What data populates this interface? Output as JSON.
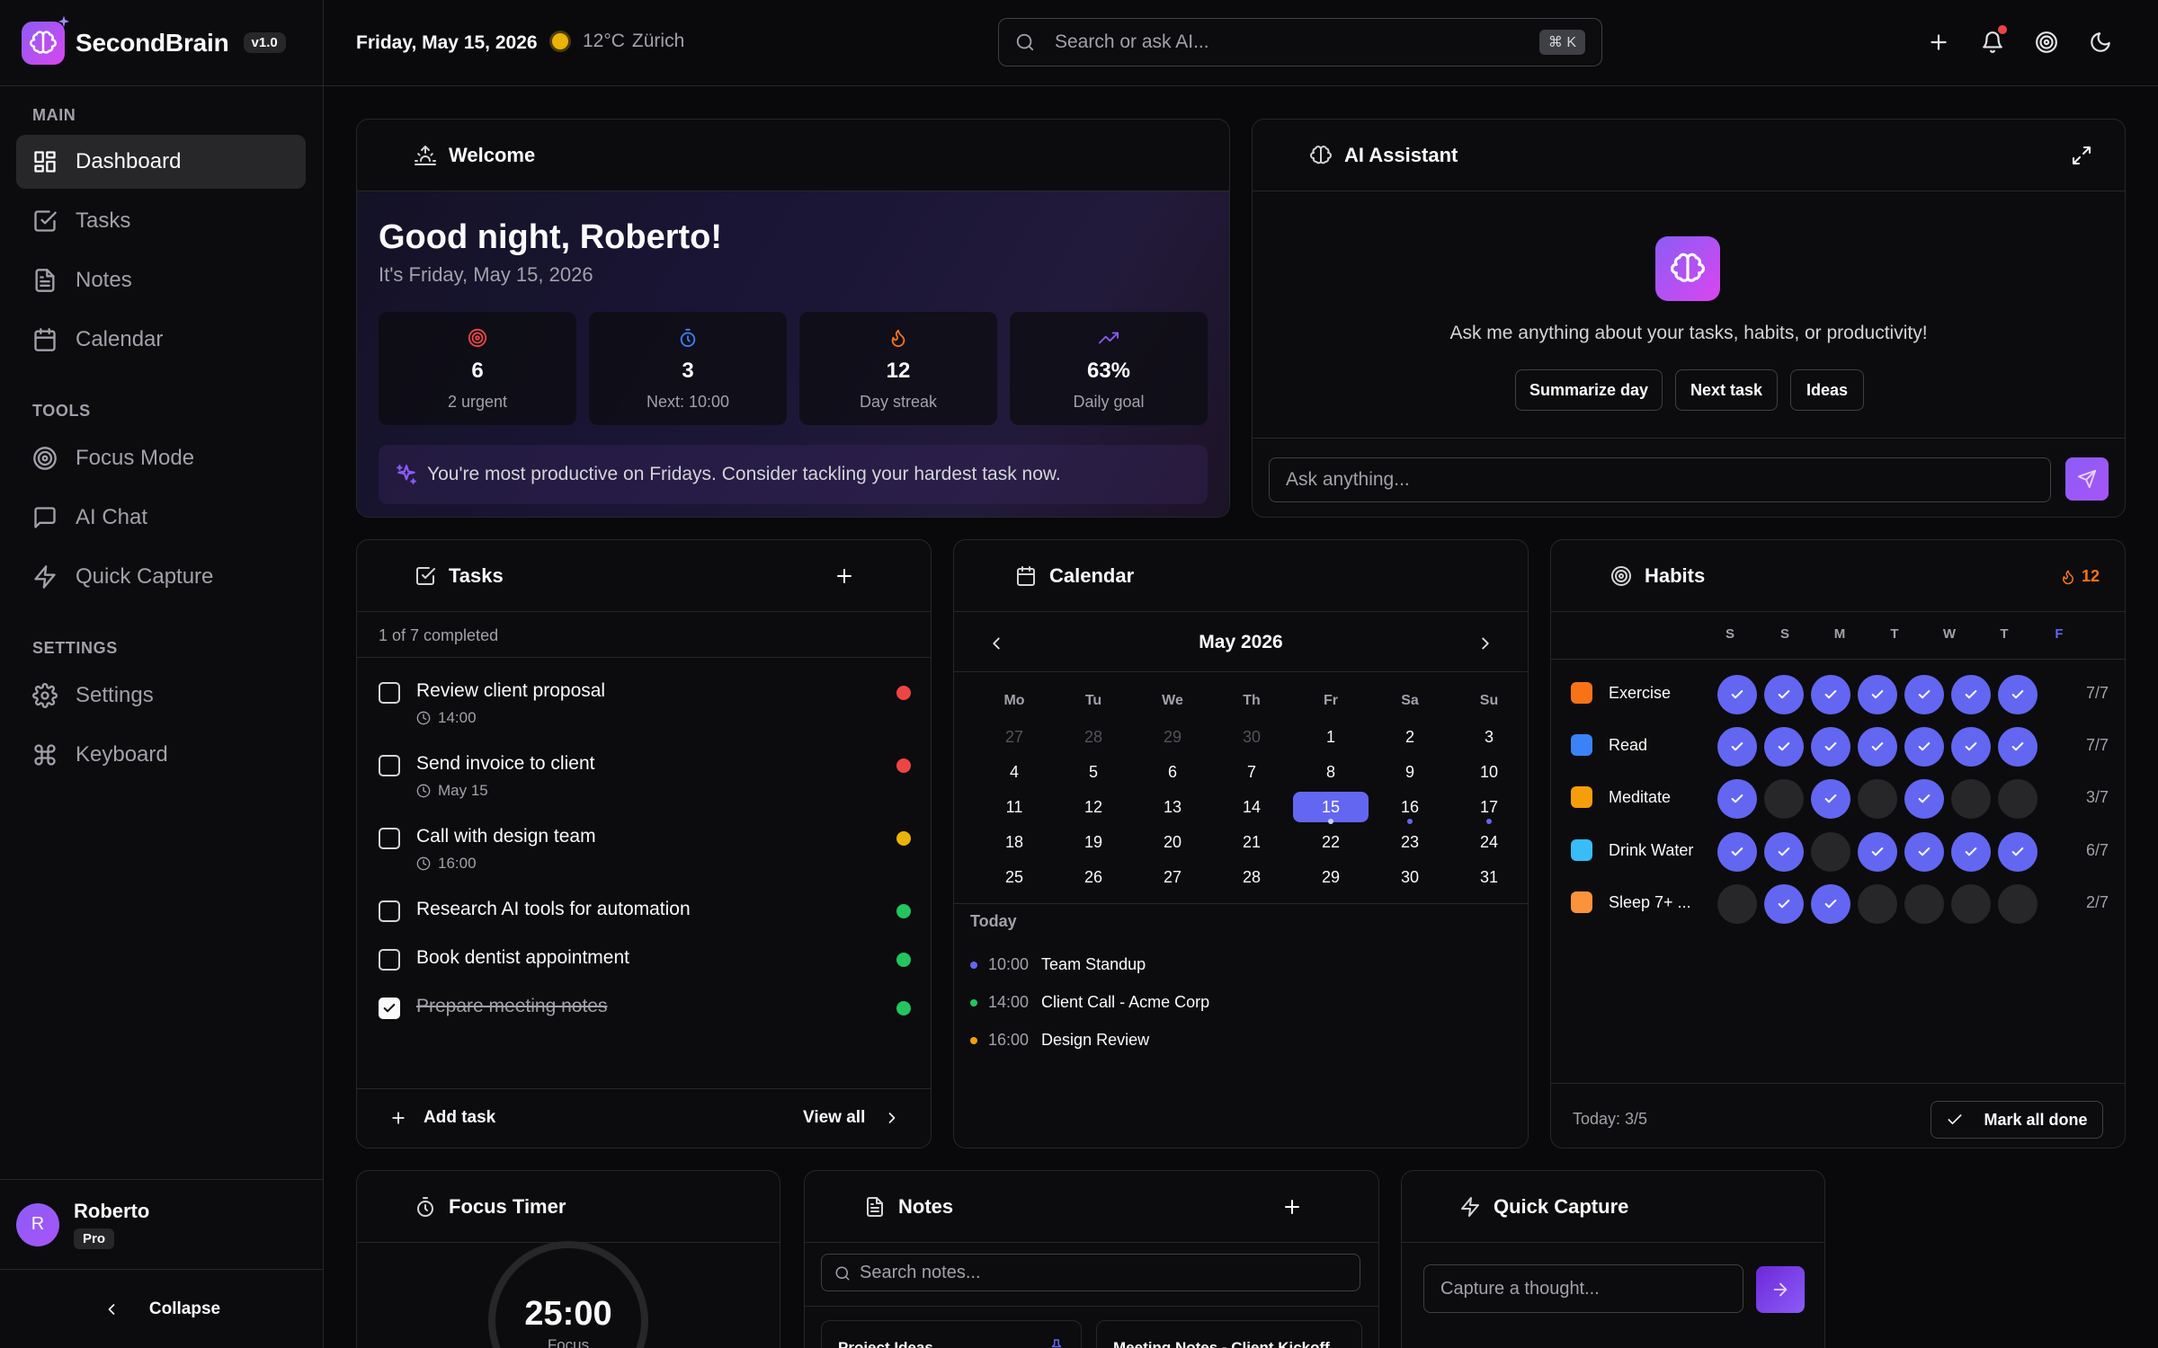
{
  "sidebar": {
    "brand": "SecondBrain",
    "version": "v1.0",
    "sections": {
      "main": "MAIN",
      "tools": "TOOLS",
      "settings": "SETTINGS"
    },
    "items": [
      {
        "label": "Dashboard",
        "icon": "grid-icon",
        "active": true
      },
      {
        "label": "Tasks",
        "icon": "check-square-icon"
      },
      {
        "label": "Notes",
        "icon": "file-text-icon"
      },
      {
        "label": "Calendar",
        "icon": "calendar-icon"
      },
      {
        "label": "Focus Mode",
        "icon": "target-icon"
      },
      {
        "label": "AI Chat",
        "icon": "message-square-icon"
      },
      {
        "label": "Quick Capture",
        "icon": "zap-icon"
      },
      {
        "label": "Settings",
        "icon": "gear-icon"
      },
      {
        "label": "Keyboard",
        "icon": "command-icon"
      }
    ],
    "user": {
      "initial": "R",
      "name": "Roberto",
      "plan": "Pro"
    },
    "collapse": "Collapse"
  },
  "topbar": {
    "date": "Friday, May 15, 2026",
    "weather": "12°C",
    "city": "Zürich",
    "search_placeholder": "Search or ask AI...",
    "shortcut": "⌘ K"
  },
  "welcome": {
    "title": "Welcome",
    "greeting": "Good night, Roberto!",
    "subtitle": "It's Friday, May 15, 2026",
    "stats": [
      {
        "value": "6",
        "label": "2 urgent",
        "color": "#ef4444"
      },
      {
        "value": "3",
        "label": "Next: 10:00",
        "color": "#3b82f6"
      },
      {
        "value": "12",
        "label": "Day streak",
        "color": "#f97316"
      },
      {
        "value": "63%",
        "label": "Daily goal",
        "color": "#8b5cf6"
      }
    ],
    "insight": "You're most productive on Fridays. Consider tackling your hardest task now."
  },
  "ai": {
    "title": "AI Assistant",
    "prompt": "Ask me anything about your tasks, habits, or productivity!",
    "chips": [
      "Summarize day",
      "Next task",
      "Ideas"
    ],
    "input_placeholder": "Ask anything..."
  },
  "tasks": {
    "title": "Tasks",
    "summary": "1 of 7 completed",
    "items": [
      {
        "title": "Review client proposal",
        "meta": "14:00",
        "priority": "#ef4444",
        "done": false
      },
      {
        "title": "Send invoice to client",
        "meta": "May 15",
        "priority": "#ef4444",
        "done": false
      },
      {
        "title": "Call with design team",
        "meta": "16:00",
        "priority": "#eab308",
        "done": false
      },
      {
        "title": "Research AI tools for automation",
        "meta": "",
        "priority": "#22c55e",
        "done": false
      },
      {
        "title": "Book dentist appointment",
        "meta": "",
        "priority": "#22c55e",
        "done": false
      },
      {
        "title": "Prepare meeting notes",
        "meta": "",
        "priority": "#22c55e",
        "done": true
      }
    ],
    "add_label": "Add task",
    "view_all": "View all"
  },
  "calendar": {
    "title": "Calendar",
    "month": "May 2026",
    "weekdays": [
      "Mo",
      "Tu",
      "We",
      "Th",
      "Fr",
      "Sa",
      "Su"
    ],
    "weeks": [
      [
        "27",
        "28",
        "29",
        "30",
        "1",
        "2",
        "3"
      ],
      [
        "4",
        "5",
        "6",
        "7",
        "8",
        "9",
        "10"
      ],
      [
        "11",
        "12",
        "13",
        "14",
        "15",
        "16",
        "17"
      ],
      [
        "18",
        "19",
        "20",
        "21",
        "22",
        "23",
        "24"
      ],
      [
        "25",
        "26",
        "27",
        "28",
        "29",
        "30",
        "31"
      ]
    ],
    "today_label": "Today",
    "events": [
      {
        "time": "10:00",
        "title": "Team Standup",
        "color": "#6366f1"
      },
      {
        "time": "14:00",
        "title": "Client Call - Acme Corp",
        "color": "#22c55e"
      },
      {
        "time": "16:00",
        "title": "Design Review",
        "color": "#f59e0b"
      }
    ]
  },
  "habits": {
    "title": "Habits",
    "streak": "12",
    "days": [
      "S",
      "S",
      "M",
      "T",
      "W",
      "T",
      "F"
    ],
    "rows": [
      {
        "name": "Exercise",
        "emoji_color": "#f97316",
        "checks": [
          1,
          1,
          1,
          1,
          1,
          1,
          1
        ],
        "count": "7/7"
      },
      {
        "name": "Read",
        "emoji_color": "#3b82f6",
        "checks": [
          1,
          1,
          1,
          1,
          1,
          1,
          1
        ],
        "count": "7/7"
      },
      {
        "name": "Meditate",
        "emoji_color": "#f59e0b",
        "checks": [
          1,
          0,
          1,
          0,
          1,
          0,
          0
        ],
        "count": "3/7"
      },
      {
        "name": "Drink Water",
        "emoji_color": "#38bdf8",
        "checks": [
          1,
          1,
          0,
          1,
          1,
          1,
          1
        ],
        "count": "6/7"
      },
      {
        "name": "Sleep 7+ ...",
        "emoji_color": "#fb923c",
        "checks": [
          0,
          1,
          1,
          0,
          0,
          0,
          0
        ],
        "count": "2/7"
      }
    ],
    "today": "Today: 3/5",
    "mark_all": "Mark all done"
  },
  "focus": {
    "title": "Focus Timer",
    "time": "25:00",
    "mode": "Focus"
  },
  "notes": {
    "title": "Notes",
    "search_placeholder": "Search notes...",
    "cards": [
      "Project Ideas",
      "Meeting Notes - Client Kickoff"
    ]
  },
  "capture": {
    "title": "Quick Capture",
    "placeholder": "Capture a thought..."
  }
}
